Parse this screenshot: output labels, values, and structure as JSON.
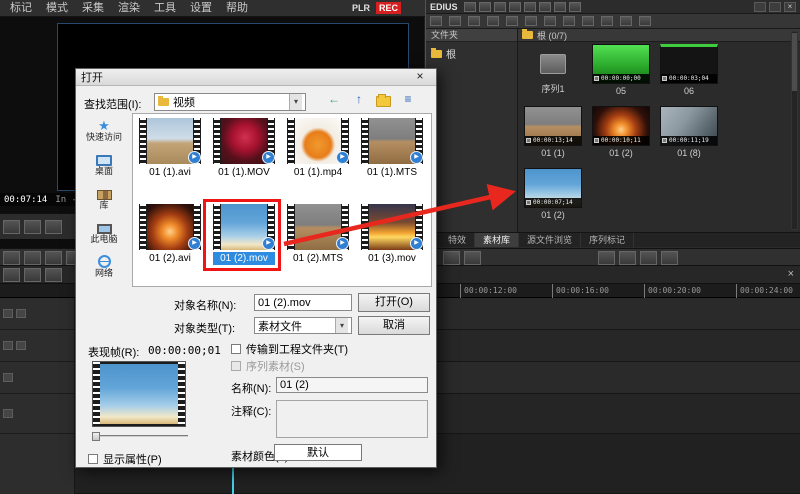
{
  "icons": {
    "play": "▶",
    "chevron_down": "▾",
    "close": "×",
    "back_arrow": "←",
    "up_arrow": "↑",
    "view_menu": "≡"
  },
  "menubar": {
    "items": [
      "标记",
      "模式",
      "采集",
      "渲染",
      "工具",
      "设置",
      "帮助"
    ],
    "plr": "PLR",
    "rec": "REC"
  },
  "monitor": {
    "timecode": "00:07:14",
    "in_text": "In --:--;--"
  },
  "bin": {
    "app_title": "EDIUS",
    "folders_label": "文件夹",
    "root_label": "根",
    "path_label": "根 (0/7)",
    "clips": [
      {
        "label": "序列1",
        "timecode": ""
      },
      {
        "label": "05",
        "timecode": "00:00:00;00"
      },
      {
        "label": "06",
        "timecode": "00:00:03;04"
      },
      {
        "label": "01 (1)",
        "timecode": "00:00:13;14"
      },
      {
        "label": "01 (2)",
        "timecode": "00:00:10;11"
      },
      {
        "label": "01 (8)",
        "timecode": "00:00:11;19"
      },
      {
        "label": "01 (2)",
        "timecode": "00:00:07;14"
      }
    ],
    "tabs": [
      {
        "label": "特效"
      },
      {
        "label": "素材库"
      },
      {
        "label": "源文件浏览"
      },
      {
        "label": "序列标记"
      }
    ]
  },
  "timeline": {
    "ruler": [
      "00:00:12:00",
      "00:00:16:00",
      "00:00:20:00",
      "00:00:24:00"
    ]
  },
  "dialog": {
    "title": "打开",
    "look_in_label": "查找范围(I):",
    "look_in_value": "视频",
    "sidebar": [
      {
        "label": "快速访问"
      },
      {
        "label": "桌面"
      },
      {
        "label": "库"
      },
      {
        "label": "此电脑"
      },
      {
        "label": "网络"
      }
    ],
    "files": [
      {
        "name": "01 (1).avi"
      },
      {
        "name": "01 (1).MOV"
      },
      {
        "name": "01 (1).mp4"
      },
      {
        "name": "01 (1).MTS"
      },
      {
        "name": "01 (2).avi"
      },
      {
        "name": "01 (2).mov"
      },
      {
        "name": "01 (2).MTS"
      },
      {
        "name": "01 (3).mov"
      }
    ],
    "file_name_label": "对象名称(N):",
    "file_name_value": "01 (2).mov",
    "file_type_label": "对象类型(T):",
    "file_type_value": "素材文件",
    "open_button": "打开(O)",
    "cancel_button": "取消",
    "poster_label": "表现帧(R):",
    "poster_value": "00:00:00;01",
    "transfer_label": "传输到工程文件夹(T)",
    "seq_label": "序列素材(S)",
    "name_label": "名称(N):",
    "name_value": "01 (2)",
    "comment_label": "注释(C):",
    "comment_value": "",
    "color_label": "素材颜色(L):",
    "default_button": "默认",
    "show_props_label": "显示属性(P)"
  }
}
